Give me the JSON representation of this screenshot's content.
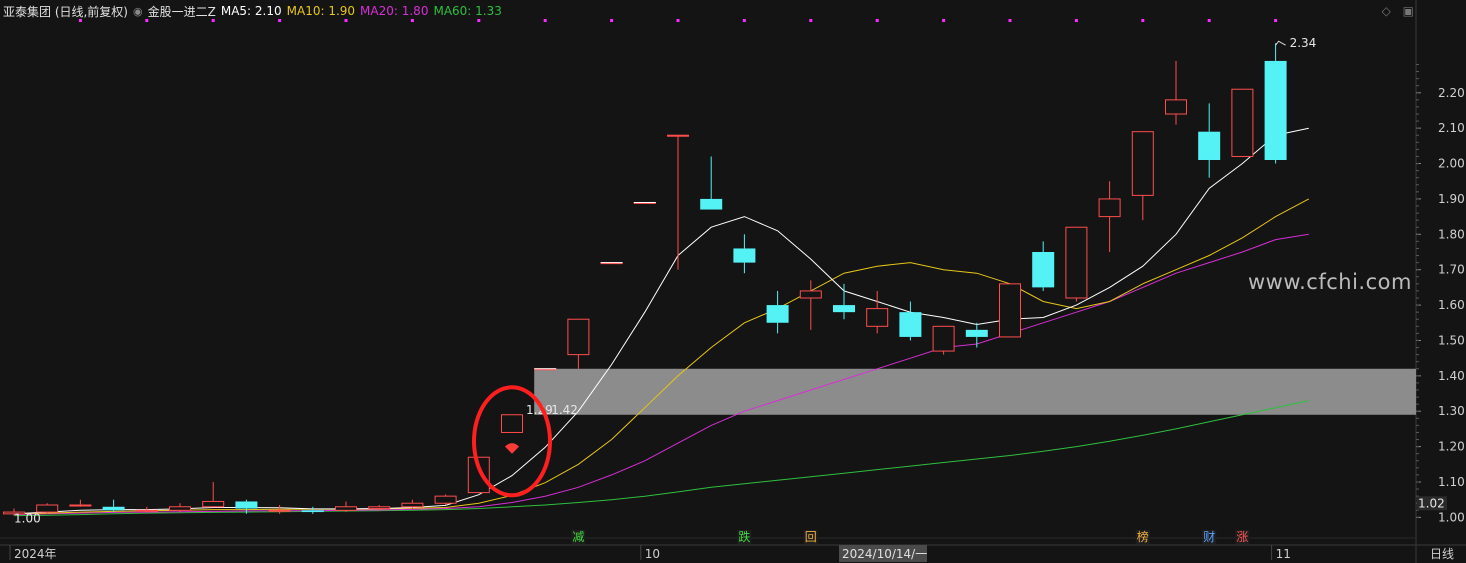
{
  "header": {
    "stock": "亚泰集团 (日线,前复权)",
    "indicator": "金股一进二Z",
    "ma": [
      {
        "label": "MA5: 2.10",
        "color": "#ffffff"
      },
      {
        "label": "MA10: 1.90",
        "color": "#e6c619"
      },
      {
        "label": "MA20: 1.80",
        "color": "#d62fd6"
      },
      {
        "label": "MA60: 1.33",
        "color": "#2fbf3f"
      }
    ]
  },
  "watermark": "www.cfchi.com",
  "period_label": "日线",
  "colors": {
    "up": "#ff4d4d",
    "down": "#54f1f5",
    "ma5": "#ffffff",
    "ma10": "#e6c619",
    "ma20": "#d62fd6",
    "ma60": "#2fbf3f",
    "zone": "#8c8c8c",
    "highlight_circle": "#ff1f1f",
    "signal_marker": "#ff2aff"
  },
  "chart_data": {
    "type": "candlestick",
    "ylim": [
      0.97,
      2.4
    ],
    "y_ticks": [
      "2.20",
      "2.10",
      "2.00",
      "1.90",
      "1.80",
      "1.70",
      "1.60",
      "1.50",
      "1.40",
      "1.30",
      "1.20",
      "1.10",
      "1.00"
    ],
    "y_tick_values": [
      2.2,
      2.1,
      2.0,
      1.9,
      1.8,
      1.7,
      1.6,
      1.5,
      1.4,
      1.3,
      1.2,
      1.1,
      1.0
    ],
    "current_price": "1.02",
    "x_labels": [
      "2024年",
      "10",
      "2024/10/14/一",
      "11"
    ],
    "x_label_index": [
      0,
      19,
      25,
      38
    ],
    "candles": [
      {
        "o": 1.01,
        "h": 1.025,
        "l": 1.005,
        "c": 1.015
      },
      {
        "o": 1.015,
        "h": 1.04,
        "l": 1.01,
        "c": 1.035
      },
      {
        "o": 1.035,
        "h": 1.05,
        "l": 1.03,
        "c": 1.035
      },
      {
        "o": 1.03,
        "h": 1.05,
        "l": 1.015,
        "c": 1.02
      },
      {
        "o": 1.02,
        "h": 1.03,
        "l": 1.015,
        "c": 1.02
      },
      {
        "o": 1.02,
        "h": 1.04,
        "l": 1.015,
        "c": 1.03
      },
      {
        "o": 1.03,
        "h": 1.1,
        "l": 1.03,
        "c": 1.045
      },
      {
        "o": 1.045,
        "h": 1.05,
        "l": 1.01,
        "c": 1.025
      },
      {
        "o": 1.02,
        "h": 1.035,
        "l": 1.01,
        "c": 1.02
      },
      {
        "o": 1.02,
        "h": 1.03,
        "l": 1.01,
        "c": 1.015
      },
      {
        "o": 1.02,
        "h": 1.045,
        "l": 1.015,
        "c": 1.03
      },
      {
        "o": 1.025,
        "h": 1.035,
        "l": 1.02,
        "c": 1.03
      },
      {
        "o": 1.03,
        "h": 1.05,
        "l": 1.025,
        "c": 1.04
      },
      {
        "o": 1.04,
        "h": 1.065,
        "l": 1.035,
        "c": 1.06
      },
      {
        "o": 1.07,
        "h": 1.17,
        "l": 1.07,
        "c": 1.17
      },
      {
        "o": 1.24,
        "h": 1.29,
        "l": 1.24,
        "c": 1.29
      },
      {
        "o": 1.42,
        "h": 1.42,
        "l": 1.42,
        "c": 1.42
      },
      {
        "o": 1.46,
        "h": 1.56,
        "l": 1.42,
        "c": 1.56
      },
      {
        "o": 1.72,
        "h": 1.72,
        "l": 1.72,
        "c": 1.72
      },
      {
        "o": 1.89,
        "h": 1.89,
        "l": 1.89,
        "c": 1.89
      },
      {
        "o": 2.08,
        "h": 2.08,
        "l": 1.7,
        "c": 2.08
      },
      {
        "o": 1.9,
        "h": 2.02,
        "l": 1.87,
        "c": 1.87
      },
      {
        "o": 1.76,
        "h": 1.8,
        "l": 1.69,
        "c": 1.72
      },
      {
        "o": 1.6,
        "h": 1.64,
        "l": 1.52,
        "c": 1.55
      },
      {
        "o": 1.62,
        "h": 1.67,
        "l": 1.53,
        "c": 1.64
      },
      {
        "o": 1.6,
        "h": 1.66,
        "l": 1.56,
        "c": 1.58
      },
      {
        "o": 1.54,
        "h": 1.64,
        "l": 1.52,
        "c": 1.59
      },
      {
        "o": 1.58,
        "h": 1.61,
        "l": 1.5,
        "c": 1.51
      },
      {
        "o": 1.47,
        "h": 1.54,
        "l": 1.46,
        "c": 1.54
      },
      {
        "o": 1.53,
        "h": 1.55,
        "l": 1.48,
        "c": 1.51
      },
      {
        "o": 1.51,
        "h": 1.66,
        "l": 1.51,
        "c": 1.66
      },
      {
        "o": 1.75,
        "h": 1.78,
        "l": 1.64,
        "c": 1.65
      },
      {
        "o": 1.62,
        "h": 1.82,
        "l": 1.61,
        "c": 1.82
      },
      {
        "o": 1.85,
        "h": 1.95,
        "l": 1.75,
        "c": 1.9
      },
      {
        "o": 1.91,
        "h": 2.09,
        "l": 1.84,
        "c": 2.09
      },
      {
        "o": 2.14,
        "h": 2.29,
        "l": 2.11,
        "c": 2.18
      },
      {
        "o": 2.09,
        "h": 2.17,
        "l": 1.96,
        "c": 2.01
      },
      {
        "o": 2.02,
        "h": 2.21,
        "l": 2.02,
        "c": 2.21
      },
      {
        "o": 2.29,
        "h": 2.34,
        "l": 2.0,
        "c": 2.01
      }
    ],
    "ma5": [
      1.01,
      1.015,
      1.02,
      1.022,
      1.022,
      1.024,
      1.028,
      1.028,
      1.027,
      1.024,
      1.024,
      1.025,
      1.028,
      1.034,
      1.064,
      1.118,
      1.198,
      1.3,
      1.432,
      1.58,
      1.74,
      1.82,
      1.85,
      1.81,
      1.73,
      1.64,
      1.61,
      1.58,
      1.565,
      1.545,
      1.56,
      1.565,
      1.6,
      1.65,
      1.71,
      1.8,
      1.93,
      2.0,
      2.08,
      2.1
    ],
    "ma10": [
      1.01,
      1.012,
      1.015,
      1.017,
      1.019,
      1.02,
      1.022,
      1.022,
      1.023,
      1.023,
      1.023,
      1.024,
      1.026,
      1.028,
      1.04,
      1.062,
      1.098,
      1.15,
      1.22,
      1.31,
      1.4,
      1.48,
      1.55,
      1.59,
      1.64,
      1.69,
      1.71,
      1.72,
      1.7,
      1.69,
      1.66,
      1.61,
      1.59,
      1.61,
      1.66,
      1.7,
      1.74,
      1.79,
      1.85,
      1.9
    ],
    "ma20": [
      1.008,
      1.01,
      1.012,
      1.014,
      1.015,
      1.016,
      1.017,
      1.018,
      1.019,
      1.019,
      1.02,
      1.021,
      1.023,
      1.025,
      1.03,
      1.042,
      1.06,
      1.085,
      1.12,
      1.16,
      1.21,
      1.26,
      1.3,
      1.33,
      1.36,
      1.39,
      1.42,
      1.45,
      1.48,
      1.49,
      1.52,
      1.55,
      1.58,
      1.61,
      1.65,
      1.69,
      1.72,
      1.75,
      1.785,
      1.8
    ],
    "ma60": [
      1.005,
      1.006,
      1.008,
      1.01,
      1.012,
      1.013,
      1.014,
      1.015,
      1.016,
      1.017,
      1.018,
      1.019,
      1.02,
      1.022,
      1.025,
      1.03,
      1.035,
      1.042,
      1.05,
      1.06,
      1.072,
      1.085,
      1.095,
      1.105,
      1.115,
      1.125,
      1.135,
      1.145,
      1.155,
      1.165,
      1.175,
      1.187,
      1.2,
      1.215,
      1.232,
      1.25,
      1.27,
      1.29,
      1.31,
      1.33
    ],
    "zone": {
      "low": 1.29,
      "high": 1.42,
      "start_index": 16
    },
    "annotations": [
      {
        "index": 15,
        "value": 1.29,
        "text": "1.29"
      },
      {
        "index": 16,
        "value": 1.29,
        "text": "1.42"
      },
      {
        "index": 38,
        "value": 2.34,
        "text": "2.34"
      },
      {
        "index": 0,
        "value": 1.0,
        "text": "1.00"
      }
    ],
    "bottom_markers": [
      {
        "index": 17,
        "text": "减",
        "color": "#3fdc3f"
      },
      {
        "index": 22,
        "text": "跌",
        "color": "#3fdc3f"
      },
      {
        "index": 24,
        "text": "回",
        "color": "#f0b040"
      },
      {
        "index": 34,
        "text": "榜",
        "color": "#f0b040"
      },
      {
        "index": 36,
        "text": "财",
        "color": "#5aa0ff"
      },
      {
        "index": 37,
        "text": "涨",
        "color": "#ff5555"
      }
    ],
    "top_signal_indices": [
      2,
      4,
      6,
      8,
      10,
      12,
      14,
      16,
      18,
      20,
      22,
      24,
      26,
      28,
      30,
      32,
      34,
      36,
      38
    ],
    "highlight_index": 15
  }
}
